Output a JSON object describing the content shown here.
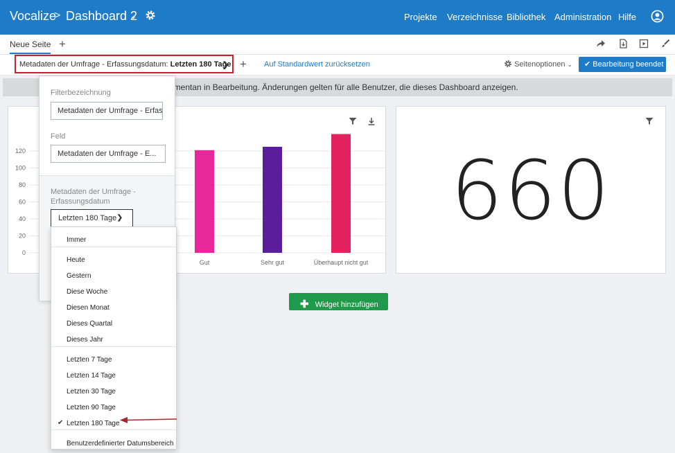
{
  "header": {
    "brand": "Vocalize",
    "separator": ">",
    "dashboard_title": "Dashboard 2",
    "nav": [
      "Projekte",
      "Verzeichnisse",
      "Bibliothek",
      "Administration",
      "Hilfe"
    ]
  },
  "pages": {
    "tabs": [
      {
        "label": "Neue Seite"
      }
    ],
    "add_label": "+"
  },
  "filter_bar": {
    "chip_prefix": "Metadaten der Umfrage - Erfassungsdatum:",
    "chip_value": "Letzten 180 Tage",
    "add_label": "+",
    "reset_label": "Auf Standardwert zurücksetzen",
    "page_options_label": "Seitenoptionen",
    "done_label": "Bearbeitung beendet"
  },
  "banner": {
    "text": "omentan in Bearbeitung. Änderungen gelten für alle Benutzer, die dieses Dashboard anzeigen."
  },
  "filter_panel": {
    "name_label": "Filterbezeichnung",
    "name_value": "Metadaten der Umfrage - Erfas",
    "field_label": "Feld",
    "field_value": "Metadaten der Umfrage - E...",
    "date_label_1": "Metadaten der Umfrage -",
    "date_label_2": "Erfassungsdatum",
    "selected": "Letzten 180 Tage"
  },
  "dropdown": {
    "groups": [
      [
        "Immer"
      ],
      [
        "Heute",
        "Gestern",
        "Diese Woche",
        "Diesen Monat",
        "Dieses Quartal",
        "Dieses Jahr"
      ],
      [
        "Letzten 7 Tage",
        "Letzten 14 Tage",
        "Letzten 30 Tage",
        "Letzten 90 Tage",
        "Letzten 180 Tage"
      ],
      [
        "Benutzerdefinierter Datumsbereich"
      ]
    ],
    "checked": "Letzten 180 Tage"
  },
  "add_widget_label": "Widget hinzufügen",
  "kpi": {
    "value": "660"
  },
  "chart_data": {
    "type": "bar",
    "categories": [
      "Gut",
      "Sehr gut",
      "Überhaupt nicht gut"
    ],
    "values": [
      121,
      125,
      140
    ],
    "colors": [
      "#e8279a",
      "#5a1e9c",
      "#e3235f"
    ],
    "y_ticks": [
      0,
      20,
      40,
      60,
      80,
      100,
      120
    ],
    "ylim": [
      0,
      140
    ],
    "grid": true
  }
}
